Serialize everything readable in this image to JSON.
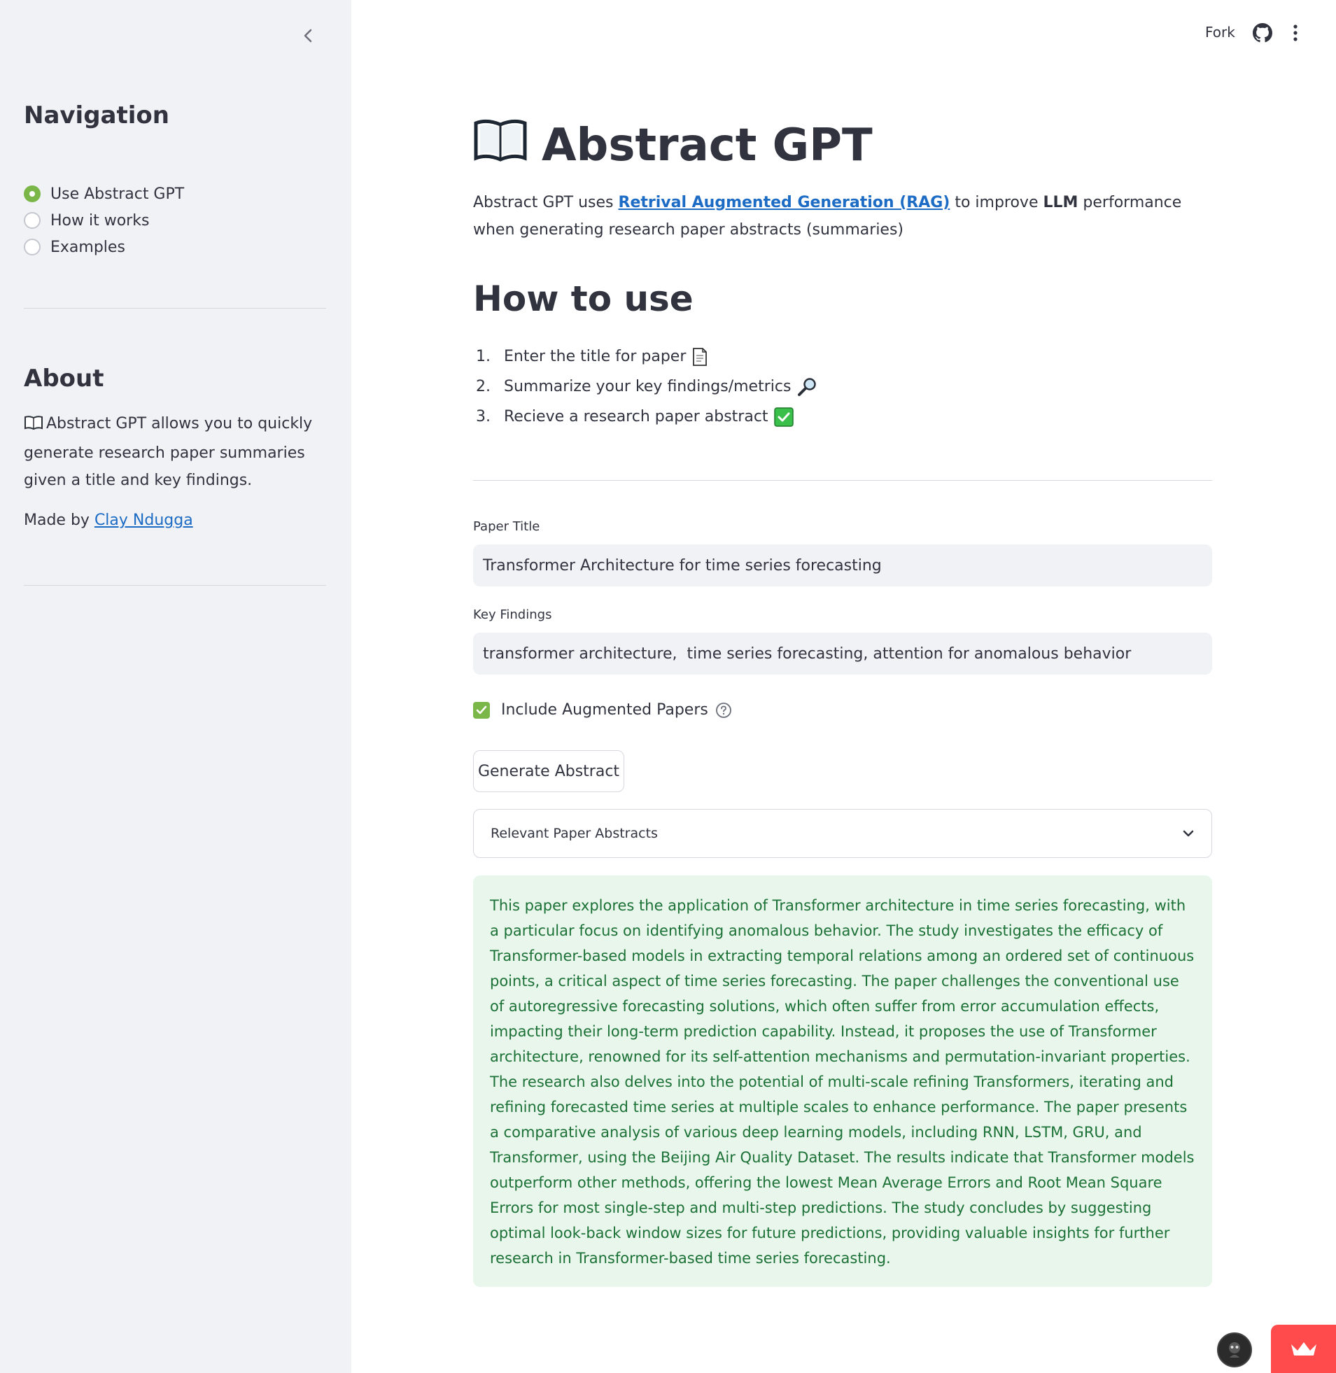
{
  "sidebar": {
    "navigation_heading": "Navigation",
    "nav_options": [
      {
        "label": "Use Abstract GPT",
        "selected": true
      },
      {
        "label": "How it works",
        "selected": false
      },
      {
        "label": "Examples",
        "selected": false
      }
    ],
    "about_heading": "About",
    "about_text": "Abstract GPT allows you to quickly generate research paper summaries given a title and key findings.",
    "made_by_prefix": "Made by ",
    "made_by_link": "Clay Ndugga"
  },
  "header": {
    "fork_label": "Fork",
    "github_icon": "github-icon",
    "menu_icon": "kebab-menu-icon"
  },
  "main": {
    "title": "Abstract GPT",
    "intro_prefix": "Abstract GPT uses ",
    "intro_link": "Retrival Augmented Generation (RAG)",
    "intro_mid": " to improve ",
    "intro_bold": "LLM",
    "intro_suffix": " performance when generating research paper abstracts (summaries)",
    "how_to_heading": "How to use",
    "steps": [
      {
        "num": "1.",
        "text": "Enter the title for paper"
      },
      {
        "num": "2.",
        "text": "Summarize your key findings/metrics"
      },
      {
        "num": "3.",
        "text": "Recieve a research paper abstract"
      }
    ],
    "paper_title_label": "Paper Title",
    "paper_title_value": "Transformer Architecture for time series forecasting",
    "key_findings_label": "Key Findings",
    "key_findings_value": "transformer architecture,  time series forecasting, attention for anomalous behavior",
    "checkbox_label": "Include Augmented Papers",
    "checkbox_checked": true,
    "generate_button": "Generate Abstract",
    "expander_label": "Relevant Paper Abstracts",
    "result_text": "This paper explores the application of Transformer architecture in time series forecasting, with a particular focus on identifying anomalous behavior. The study investigates the efficacy of Transformer-based models in extracting temporal relations among an ordered set of continuous points, a critical aspect of time series forecasting. The paper challenges the conventional use of autoregressive forecasting solutions, which often suffer from error accumulation effects, impacting their long-term prediction capability. Instead, it proposes the use of Transformer architecture, renowned for its self-attention mechanisms and permutation-invariant properties. The research also delves into the potential of multi-scale refining Transformers, iterating and refining forecasted time series at multiple scales to enhance performance. The paper presents a comparative analysis of various deep learning models, including RNN, LSTM, GRU, and Transformer, using the Beijing Air Quality Dataset. The results indicate that Transformer models outperform other methods, offering the lowest Mean Average Errors and Root Mean Square Errors for most single-step and multi-step predictions. The study concludes by suggesting optimal look-back window sizes for future predictions, providing valuable insights for further research in Transformer-based time series forecasting."
  },
  "colors": {
    "accent_green": "#7ab648",
    "success_bg": "#e8f6ec",
    "success_text": "#1c7136",
    "link_blue": "#1c6bc4",
    "sidebar_bg": "#f0f2f6",
    "badge_red": "#ff4b4b"
  }
}
